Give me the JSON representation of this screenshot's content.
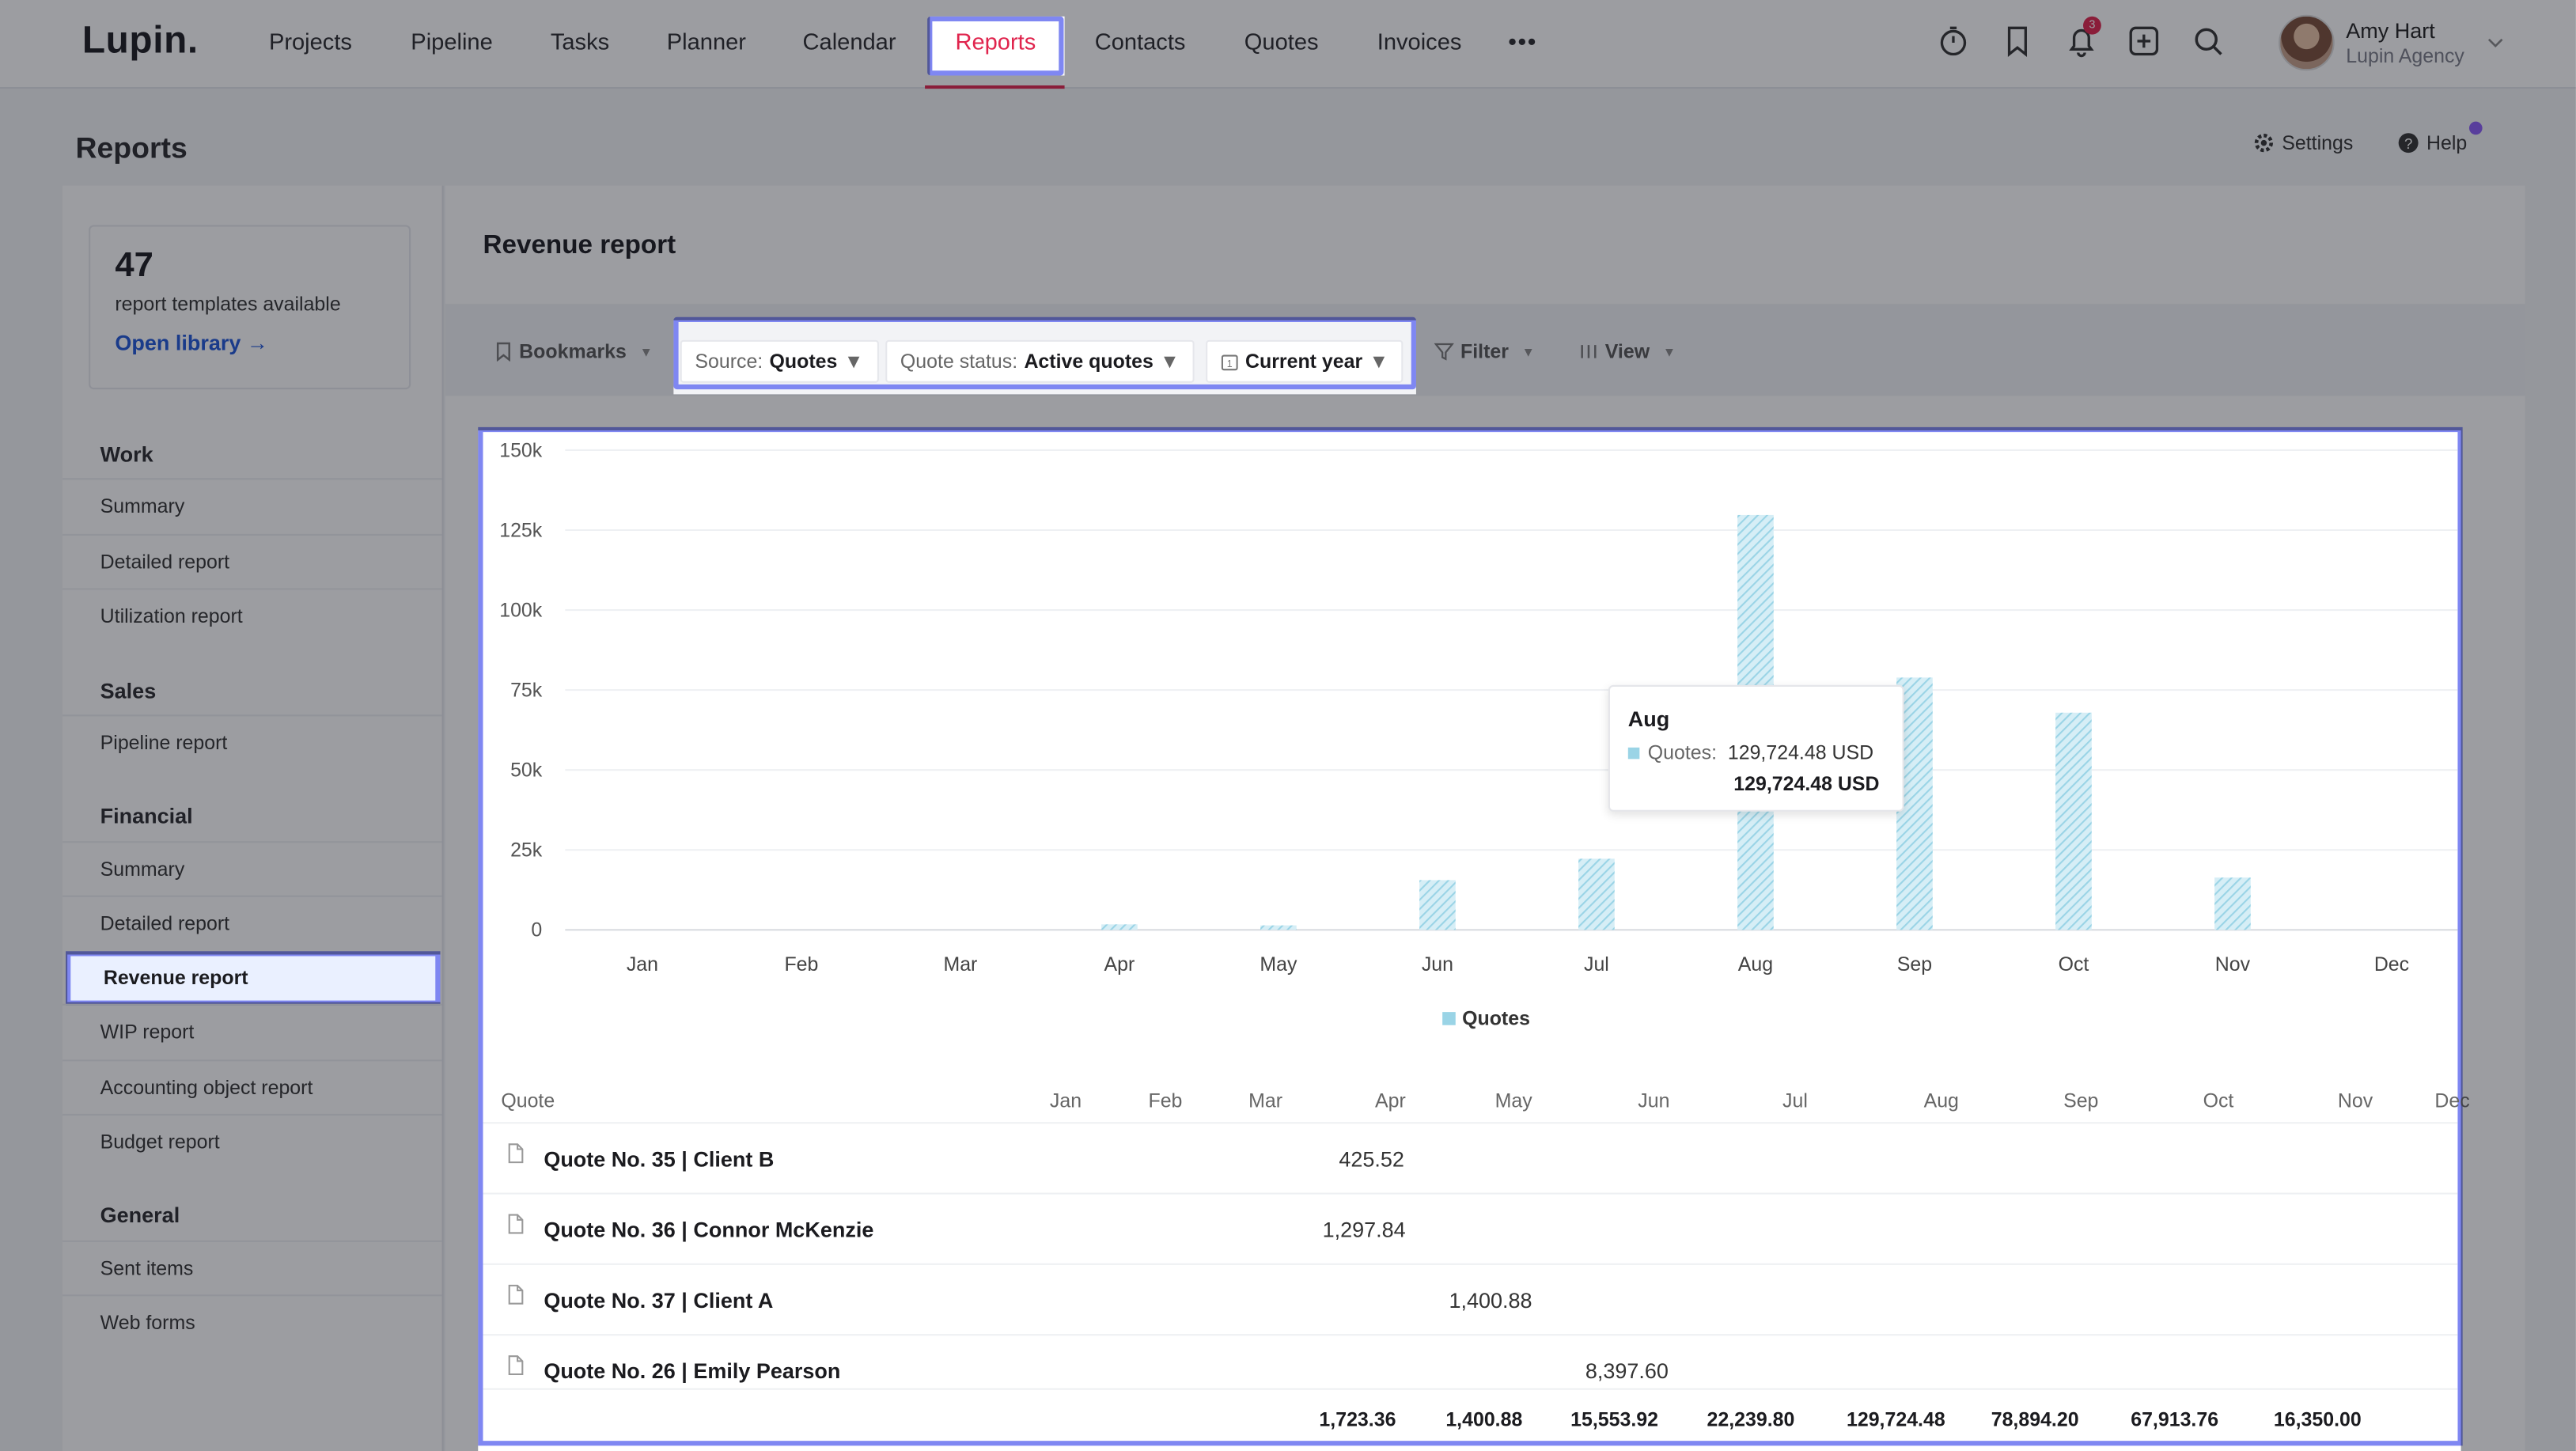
{
  "app": {
    "logo": "Lupin.",
    "active_nav": "Reports"
  },
  "nav": {
    "items": [
      "Projects",
      "Pipeline",
      "Tasks",
      "Planner",
      "Calendar",
      "Reports",
      "Contacts",
      "Quotes",
      "Invoices"
    ],
    "more": "•••",
    "notifications_count": "3"
  },
  "user": {
    "name": "Amy Hart",
    "org": "Lupin Agency"
  },
  "page": {
    "title": "Reports",
    "settings": "Settings",
    "help": "Help"
  },
  "library": {
    "count": "47",
    "text": "report templates available",
    "link": "Open library →"
  },
  "sidebar": {
    "work": {
      "title": "Work",
      "items": [
        "Summary",
        "Detailed report",
        "Utilization report"
      ]
    },
    "sales": {
      "title": "Sales",
      "items": [
        "Pipeline report"
      ]
    },
    "financial": {
      "title": "Financial",
      "items": [
        "Summary",
        "Detailed report",
        "Revenue report",
        "WIP report",
        "Accounting object report",
        "Budget report"
      ]
    },
    "general": {
      "title": "General",
      "items": [
        "Sent items",
        "Web forms"
      ]
    },
    "selected": "Revenue report"
  },
  "report": {
    "title": "Revenue report",
    "bookmarks": "Bookmarks",
    "source_label": "Source:",
    "source_value": "Quotes",
    "status_label": "Quote status:",
    "status_value": "Active quotes",
    "period": "Current year",
    "filter": "Filter",
    "view": "View"
  },
  "chart_data": {
    "type": "bar",
    "categories": [
      "Jan",
      "Feb",
      "Mar",
      "Apr",
      "May",
      "Jun",
      "Jul",
      "Aug",
      "Sep",
      "Oct",
      "Nov",
      "Dec"
    ],
    "series": [
      {
        "name": "Quotes",
        "values": [
          0,
          0,
          0,
          1723.36,
          1400.88,
          15553.92,
          22239.8,
          129724.48,
          78894.2,
          67913.76,
          16350.0,
          0
        ]
      }
    ],
    "ylim": [
      0,
      150000
    ],
    "yticks": [
      "0",
      "25k",
      "50k",
      "75k",
      "100k",
      "125k",
      "150k"
    ],
    "ytick_values": [
      0,
      25000,
      50000,
      75000,
      100000,
      125000,
      150000
    ],
    "legend": "bottom",
    "grid": true,
    "bar_color": "#9ad4e6"
  },
  "tooltip": {
    "month": "Aug",
    "label": "Quotes:",
    "value": "129,724.48 USD",
    "total": "129,724.48 USD"
  },
  "table": {
    "header": "Quote",
    "months": [
      "Jan",
      "Feb",
      "Mar",
      "Apr",
      "May",
      "Jun",
      "Jul",
      "Aug",
      "Sep",
      "Oct",
      "Nov",
      "Dec"
    ],
    "rows": [
      {
        "name": "Quote No. 35 | Client B",
        "value": "425.52",
        "month": "Apr"
      },
      {
        "name": "Quote No. 36 | Connor McKenzie",
        "value": "1,297.84",
        "month": "Apr"
      },
      {
        "name": "Quote No. 37 | Client A",
        "value": "1,400.88",
        "month": "May"
      },
      {
        "name": "Quote No. 26 | Emily Pearson",
        "value": "8,397.60",
        "month": "Jun"
      }
    ],
    "totals": [
      "1,723.36",
      "1,400.88",
      "15,553.92",
      "22,239.80",
      "129,724.48",
      "78,894.20",
      "67,913.76",
      "16,350.00"
    ]
  }
}
